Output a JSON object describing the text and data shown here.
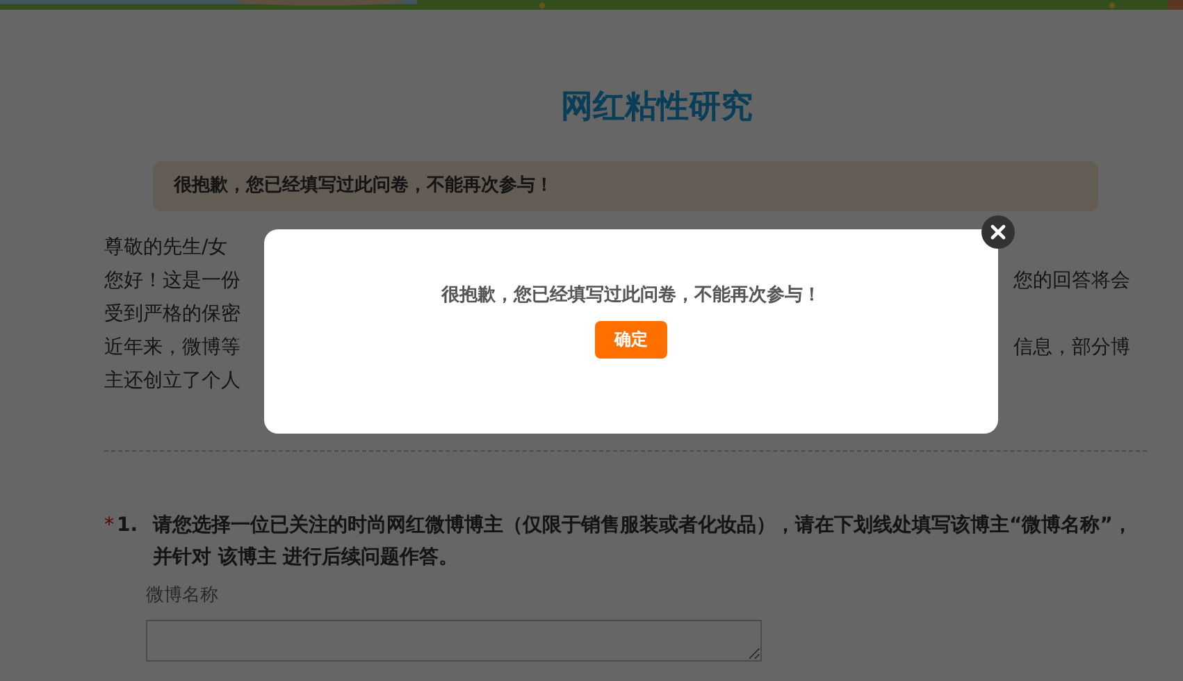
{
  "title": "网红粘性研究",
  "alert": "很抱歉，您已经填写过此问卷，不能再次参与！",
  "intro_lines": [
    {
      "left": "尊敬的先生/女"
    },
    {
      "left": "您好！这是一份",
      "right": "您的回答将会"
    },
    {
      "left": "受到严格的保密"
    },
    {
      "left": "近年来，微博等",
      "right": "信息，部分博"
    },
    {
      "left": "主还创立了个人"
    }
  ],
  "questions": [
    {
      "required_mark": "*",
      "number": "1.",
      "text": "请您选择一位已关注的时尚网红微博博主（仅限于销售服装或者化妆品），请在下划线处填写该博主“微博名称”，并针对 该博主 进行后续问题作答。",
      "field_label": "微博名称"
    }
  ],
  "dialog": {
    "message": "很抱歉，您已经填写过此问卷，不能再次参与！",
    "confirm": "确定"
  }
}
